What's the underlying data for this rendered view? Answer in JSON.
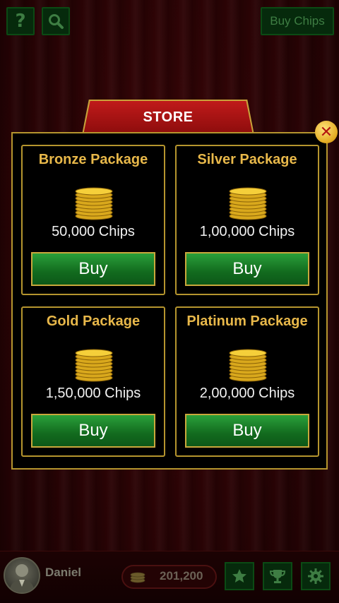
{
  "top_bar": {
    "help_icon": "question-mark-icon",
    "search_icon": "magnifier-icon",
    "buy_chips_label": "Buy Chips"
  },
  "store": {
    "title": "STORE",
    "close_icon": "close-x-icon",
    "packages": [
      {
        "name": "Bronze Package",
        "chips": "50,000 Chips",
        "buy_label": "Buy"
      },
      {
        "name": "Silver Package",
        "chips": "1,00,000 Chips",
        "buy_label": "Buy"
      },
      {
        "name": "Gold Package",
        "chips": "1,50,000 Chips",
        "buy_label": "Buy"
      },
      {
        "name": "Platinum Package",
        "chips": "2,00,000 Chips",
        "buy_label": "Buy"
      }
    ]
  },
  "bottom_bar": {
    "username": "Daniel",
    "balance": "201,200",
    "icons": [
      "star-icon",
      "trophy-icon",
      "gear-icon"
    ]
  },
  "colors": {
    "accent_gold": "#e8b84a",
    "button_green": "#126a1e",
    "tab_red": "#c01a1a"
  }
}
